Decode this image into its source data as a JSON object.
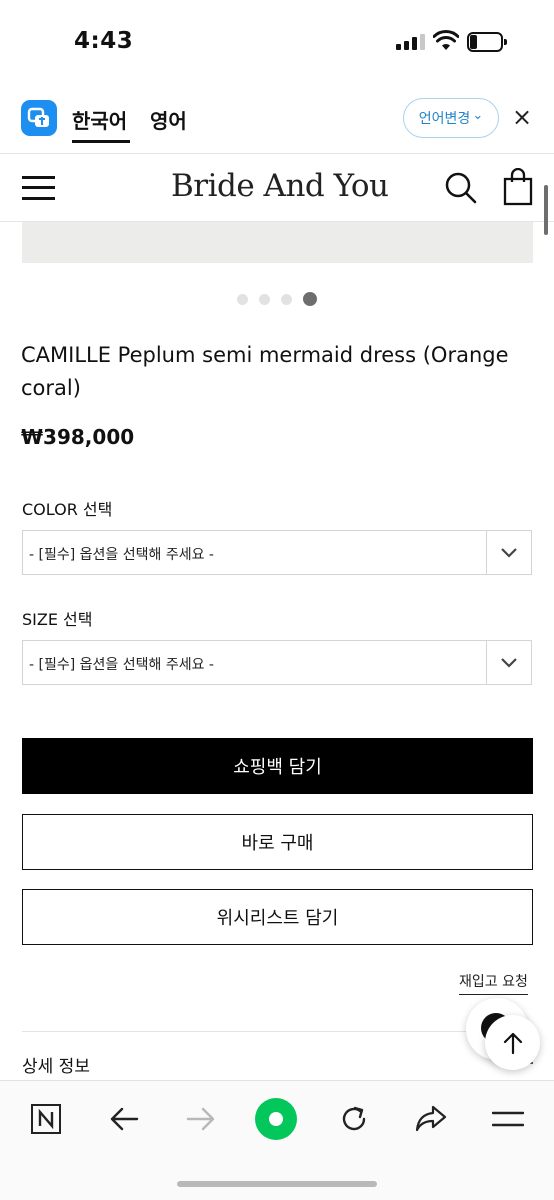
{
  "status_bar": {
    "time": "4:43",
    "battery_level": 0.25
  },
  "translate_bar": {
    "current_language": "한국어",
    "other_language": "영어",
    "change_language_button": "언어변경",
    "change_language_chevron": "⌄",
    "close_symbol": "×",
    "brand_color": "#1c8ff0"
  },
  "header": {
    "brand": "Bride And You",
    "icons": [
      "hamburger-menu-icon",
      "search-icon",
      "shopping-bag-icon"
    ]
  },
  "carousel": {
    "slide_count": 4,
    "active_index": 3
  },
  "product": {
    "name": "CAMILLE Peplum semi mermaid dress (Orange coral)",
    "price": "₩398,000"
  },
  "options": [
    {
      "label": "COLOR 선택",
      "selected": "- [필수] 옵션을 선택해 주세요 -"
    },
    {
      "label": "SIZE 선택",
      "selected": "- [필수] 옵션을 선택해 주세요 -"
    }
  ],
  "buttons": {
    "add_to_bag": "쇼핑백 담기",
    "buy_now": "바로 구매",
    "wishlist": "위시리스트 담기",
    "restock_request": "재입고 요청"
  },
  "details": {
    "title": "상세 정보"
  },
  "browser_toolbar": {
    "icons": [
      "naver-n-icon",
      "back-arrow-icon",
      "forward-arrow-icon",
      "green-home-icon",
      "reload-icon",
      "share-icon",
      "menu-icon"
    ],
    "accent_color": "#03c75a"
  }
}
